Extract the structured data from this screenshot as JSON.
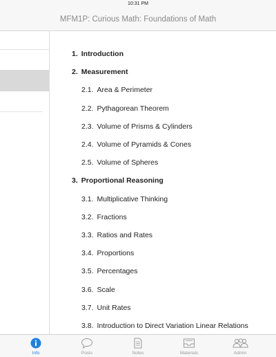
{
  "status_bar": {
    "time": "10:31 PM"
  },
  "nav": {
    "title": "MFM1P: Curious Math: Foundations of Math"
  },
  "toc": [
    {
      "num": "1.",
      "label": "Introduction",
      "level": "chapter"
    },
    {
      "num": "2.",
      "label": "Measurement",
      "level": "chapter"
    },
    {
      "num": "2.1.",
      "label": "Area & Perimeter",
      "level": "section"
    },
    {
      "num": "2.2.",
      "label": "Pythagorean Theorem",
      "level": "section"
    },
    {
      "num": "2.3.",
      "label": "Volume of Prisms & Cylinders",
      "level": "section"
    },
    {
      "num": "2.4.",
      "label": "Volume of Pyramids & Cones",
      "level": "section"
    },
    {
      "num": "2.5.",
      "label": "Volume of Spheres",
      "level": "section"
    },
    {
      "num": "3.",
      "label": "Proportional Reasoning",
      "level": "chapter"
    },
    {
      "num": "3.1.",
      "label": "Multiplicative Thinking",
      "level": "section"
    },
    {
      "num": "3.2.",
      "label": "Fractions",
      "level": "section"
    },
    {
      "num": "3.3.",
      "label": "Ratios and Rates",
      "level": "section"
    },
    {
      "num": "3.4.",
      "label": "Proportions",
      "level": "section"
    },
    {
      "num": "3.5.",
      "label": "Percentages",
      "level": "section"
    },
    {
      "num": "3.6.",
      "label": "Scale",
      "level": "section"
    },
    {
      "num": "3.7.",
      "label": "Unit Rates",
      "level": "section"
    },
    {
      "num": "3.8.",
      "label": "Introduction to Direct Variation Linear Relations",
      "level": "section"
    }
  ],
  "tabs": [
    {
      "label": "Info",
      "icon": "info-icon",
      "active": true
    },
    {
      "label": "Posts",
      "icon": "speech-bubble-icon",
      "active": false
    },
    {
      "label": "Notes",
      "icon": "document-icon",
      "active": false
    },
    {
      "label": "Materials",
      "icon": "inbox-tray-icon",
      "active": false
    },
    {
      "label": "Admin",
      "icon": "people-icon",
      "active": false
    }
  ],
  "colors": {
    "accent": "#1a82e6",
    "inactive": "#9a9a9a",
    "selected_row": "#d9d9d9"
  }
}
